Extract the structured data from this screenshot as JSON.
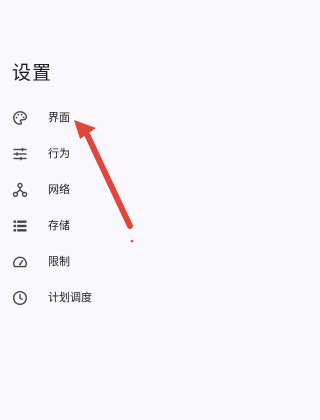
{
  "page": {
    "title": "设置"
  },
  "menu": {
    "items": [
      {
        "label": "界面",
        "icon": "palette-icon"
      },
      {
        "label": "行为",
        "icon": "tune-sliders-icon"
      },
      {
        "label": "网络",
        "icon": "network-nodes-icon"
      },
      {
        "label": "存储",
        "icon": "storage-list-icon"
      },
      {
        "label": "限制",
        "icon": "speedometer-icon"
      },
      {
        "label": "计划调度",
        "icon": "clock-icon"
      }
    ]
  },
  "colors": {
    "background": "#faf8fd",
    "text": "#1c1b1f",
    "icon": "#44474f",
    "annotation_arrow": "#e0463b"
  }
}
